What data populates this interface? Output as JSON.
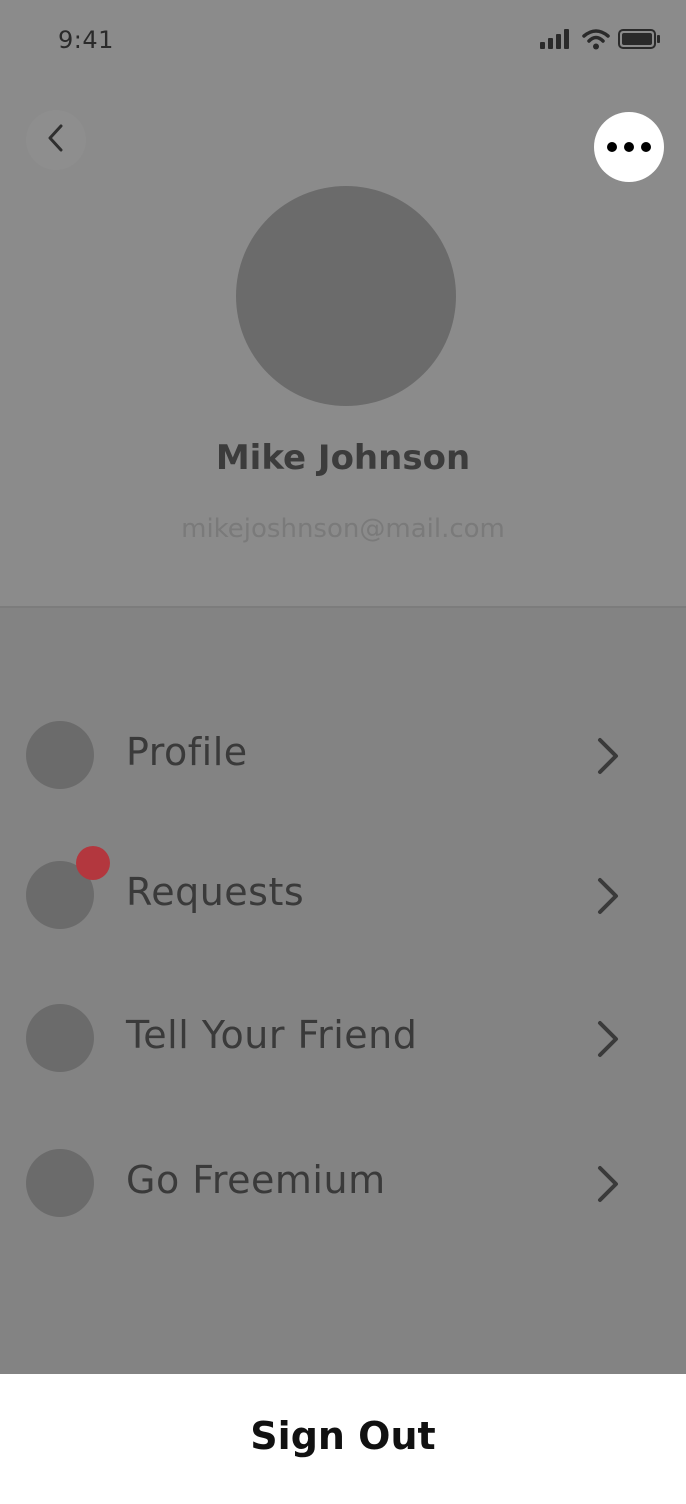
{
  "status_bar": {
    "time": "9:41",
    "icons": [
      "signal-icon",
      "wifi-icon",
      "battery-icon"
    ]
  },
  "header": {
    "back_icon": "chevron-left-icon",
    "more_icon": "more-horizontal-icon"
  },
  "profile": {
    "name": "Mike Johnson",
    "email": "mikejoshnson@mail.com"
  },
  "menu": {
    "items": [
      {
        "label": "Profile",
        "icon": "profile-icon",
        "has_badge": false
      },
      {
        "label": "Requests",
        "icon": "requests-icon",
        "has_badge": true
      },
      {
        "label": "Tell Your Friend",
        "icon": "tell-friend-icon",
        "has_badge": false
      },
      {
        "label": "Go Freemium",
        "icon": "freemium-icon",
        "has_badge": false
      }
    ]
  },
  "sign_out": {
    "label": "Sign Out"
  },
  "colors": {
    "overlay_background": "#838383",
    "header_background": "#8b8b8b",
    "badge": "#b3373e",
    "sheet_background": "#ffffff"
  }
}
